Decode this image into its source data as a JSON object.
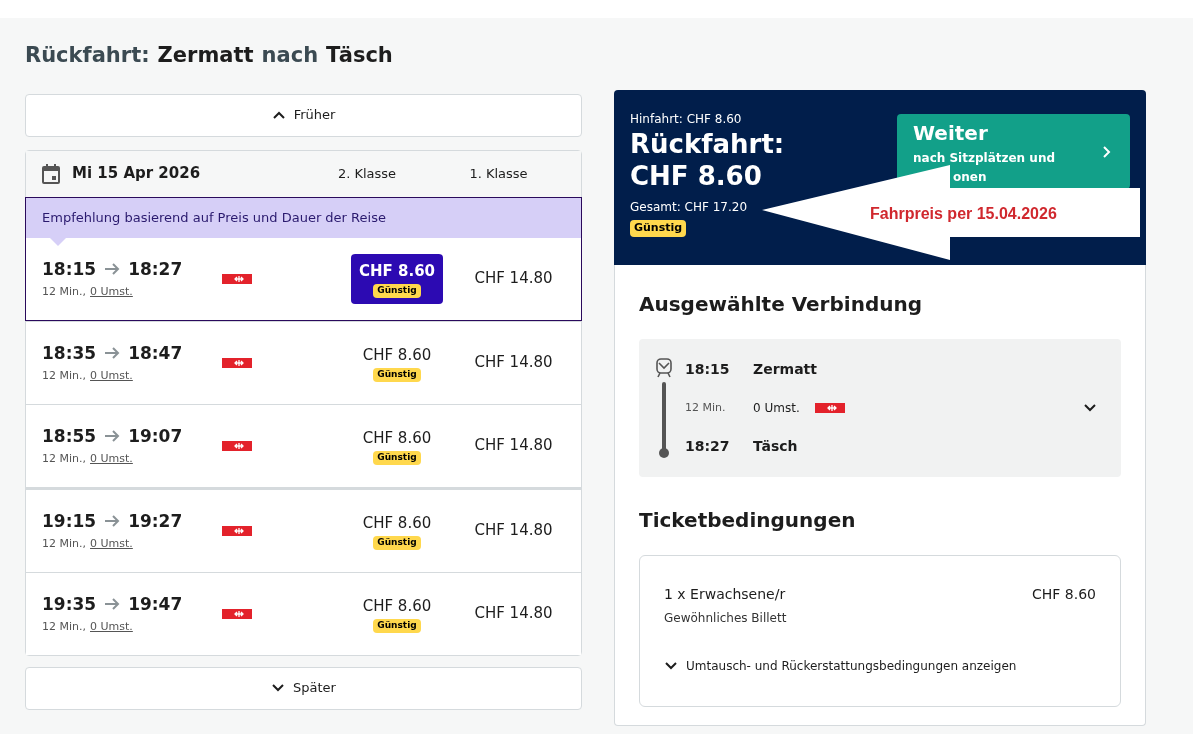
{
  "page_title": {
    "prefix": "Rückfahrt:",
    "from": "Zermatt",
    "connector": "nach",
    "to": "Täsch"
  },
  "earlier_button": "Früher",
  "later_button": "Später",
  "list_header": {
    "date": "Mi 15 Apr 2026",
    "class_2": "2. Klasse",
    "class_1": "1. Klasse"
  },
  "recommendation": "Empfehlung basierend auf Preis und Dauer der Reise",
  "connections": [
    {
      "departure": "18:15",
      "arrival": "18:27",
      "duration": "12 Min.,",
      "transfers": "0 Umst.",
      "price_2": "CHF 8.60",
      "badge": "Günstig",
      "price_1": "CHF 14.80",
      "selected": true,
      "recommended": true
    },
    {
      "departure": "18:35",
      "arrival": "18:47",
      "duration": "12 Min.,",
      "transfers": "0 Umst.",
      "price_2": "CHF 8.60",
      "badge": "Günstig",
      "price_1": "CHF 14.80",
      "selected": false,
      "recommended": false
    },
    {
      "departure": "18:55",
      "arrival": "19:07",
      "duration": "12 Min.,",
      "transfers": "0 Umst.",
      "price_2": "CHF 8.60",
      "badge": "Günstig",
      "price_1": "CHF 14.80",
      "selected": false,
      "recommended": false
    },
    {
      "departure": "19:15",
      "arrival": "19:27",
      "duration": "12 Min.,",
      "transfers": "0 Umst.",
      "price_2": "CHF 8.60",
      "badge": "Günstig",
      "price_1": "CHF 14.80",
      "selected": false,
      "recommended": false
    },
    {
      "departure": "19:35",
      "arrival": "19:47",
      "duration": "12 Min.,",
      "transfers": "0 Umst.",
      "price_2": "CHF 8.60",
      "badge": "Günstig",
      "price_1": "CHF 14.80",
      "selected": false,
      "recommended": false
    }
  ],
  "summary": {
    "outbound": "Hinfahrt: CHF 8.60",
    "return_label": "Rückfahrt:",
    "return_price": "CHF 8.60",
    "total": "Gesamt: CHF 17.20",
    "badge": "Günstig",
    "continue_title": "Weiter",
    "continue_line_1": "nach Sitzplätzen und",
    "continue_line_2": "onen"
  },
  "callout": "Fahrpreis per 15.04.2026",
  "selected_connection": {
    "heading": "Ausgewählte Verbindung",
    "departure": "18:15",
    "from": "Zermatt",
    "duration": "12 Min.",
    "transfers": "0 Umst.",
    "arrival": "18:27",
    "to": "Täsch"
  },
  "ticket_conditions": {
    "heading": "Ticketbedingungen",
    "passenger": "1 x Erwachsene/r",
    "price": "CHF 8.60",
    "ticket_type": "Gewöhnliches Billett",
    "conditions_link": "Umtausch- und Rückerstattungsbedingungen anzeigen"
  }
}
